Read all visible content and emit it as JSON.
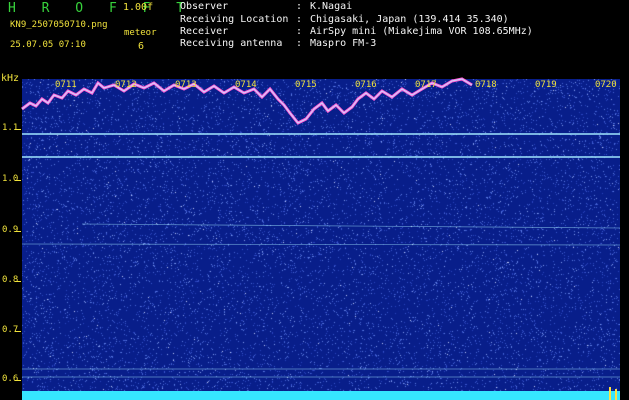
{
  "header": {
    "app_title": "H R O F F T",
    "version": "1.00f",
    "file_name": "KN9_2507050710.png",
    "timestamp": "25.07.05 07:10",
    "meteor_label": "meteor",
    "meteor_count": "6",
    "observer_label": "Observer",
    "observer_value": "K.Nagai",
    "location_label": "Receiving Location",
    "location_value": "Chigasaki, Japan (139.414 35.340)",
    "receiver_label": "Receiver",
    "receiver_value": "AirSpy mini (Miakejima VOR 108.65MHz)",
    "antenna_label": "Receiving antenna",
    "antenna_value": "Maspro FM-3",
    "separator": ":"
  },
  "spectrogram": {
    "unit_label": "kHz",
    "freq_ticks": [
      "1.1",
      "1.0",
      "0.9",
      "0.8",
      "0.7",
      "0.6"
    ],
    "time_ticks": [
      "0711",
      "0712",
      "0713",
      "0714",
      "0715",
      "0716",
      "0717",
      "0718",
      "0719",
      "0720"
    ],
    "colors": {
      "background": "#081e8a",
      "noise": "#4a6ad8",
      "carrier": "#a0e6ff",
      "trace_outer": "#ff5ad2",
      "trace_inner": "#d0d0ff",
      "bottom_band": "#36e6ff",
      "bottom_marker": "#ffe040"
    }
  }
}
